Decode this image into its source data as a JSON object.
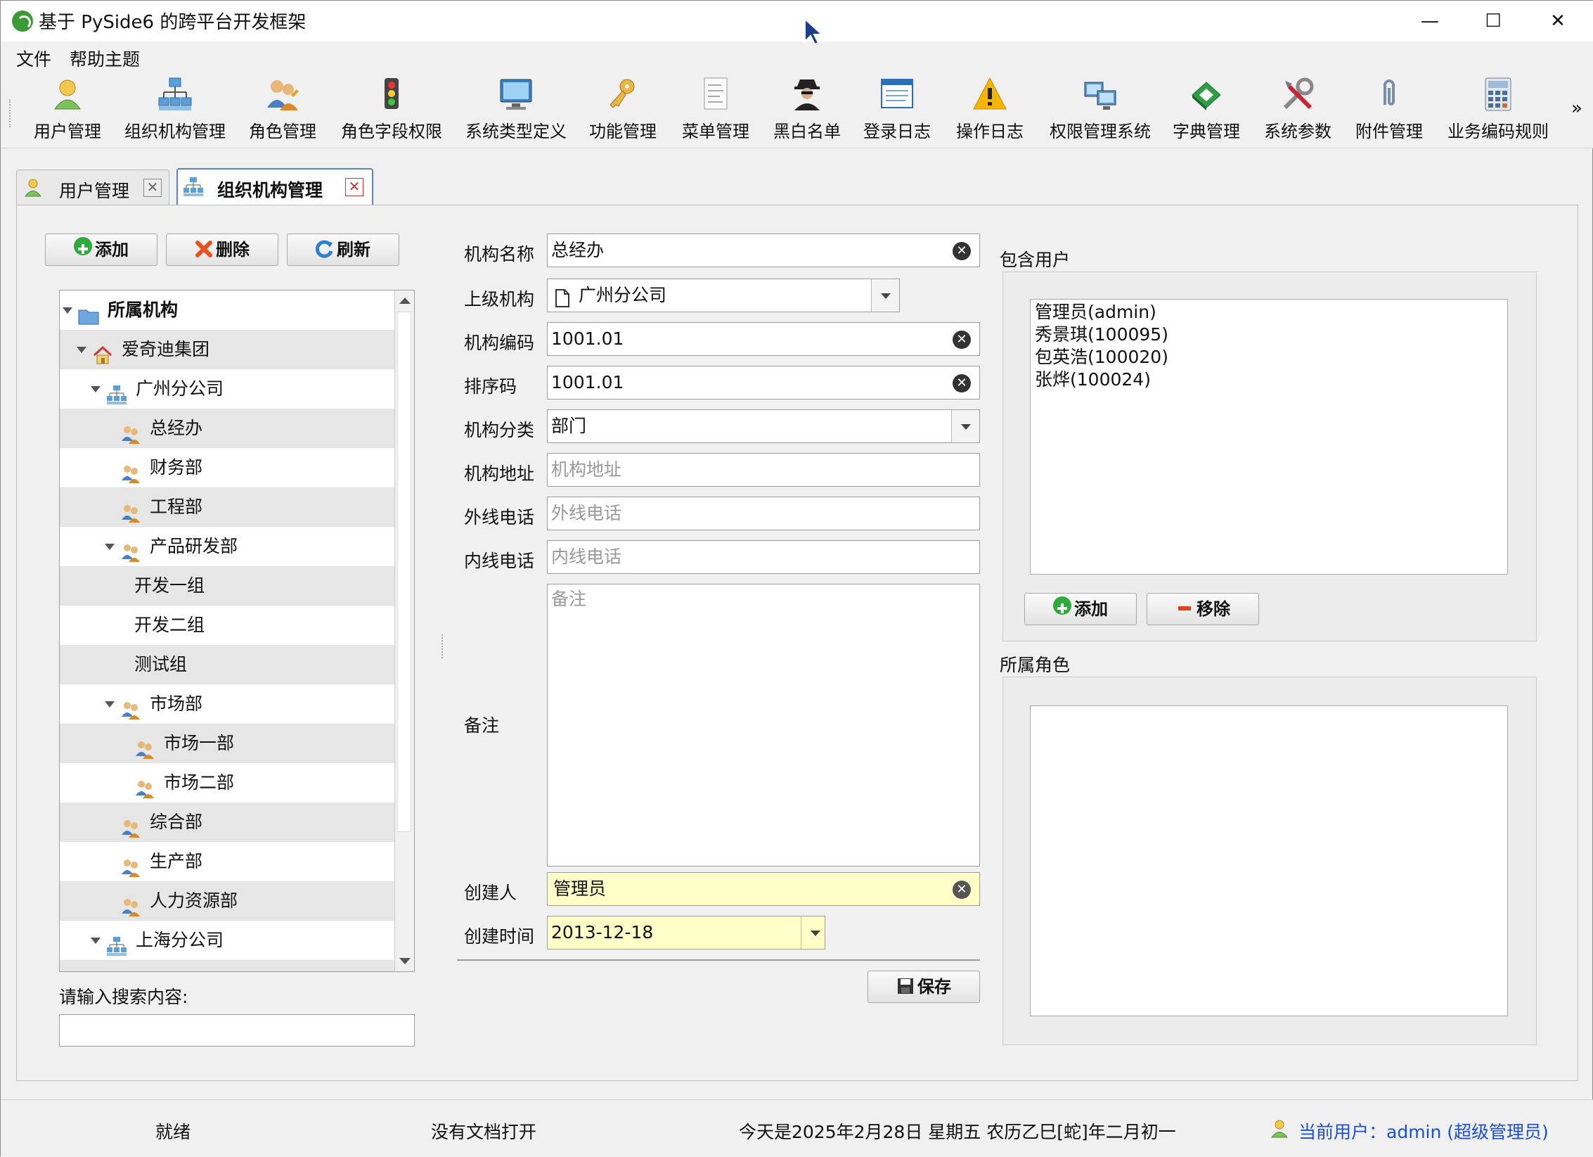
{
  "window": {
    "title": "基于 PySide6 的跨平台开发框架",
    "min_glyph": "—",
    "max_glyph": "☐",
    "close_glyph": "✕"
  },
  "menu": [
    "文件",
    "帮助主题"
  ],
  "toolbar": {
    "items": [
      "用户管理",
      "组织机构管理",
      "角色管理",
      "角色字段权限",
      "系统类型定义",
      "功能管理",
      "菜单管理",
      "黑白名单",
      "登录日志",
      "操作日志",
      "权限管理系统",
      "字典管理",
      "系统参数",
      "附件管理",
      "业务编码规则"
    ],
    "overflow": "»"
  },
  "tabs": [
    {
      "label": "用户管理",
      "close": "✕"
    },
    {
      "label": "组织机构管理",
      "close": "✕"
    }
  ],
  "left": {
    "add": "添加",
    "delete": "删除",
    "refresh": "刷新",
    "tree": [
      {
        "label": "所属机构",
        "bold": true
      },
      {
        "label": "爱奇迪集团"
      },
      {
        "label": "广州分公司"
      },
      {
        "label": "总经办"
      },
      {
        "label": "财务部"
      },
      {
        "label": "工程部"
      },
      {
        "label": "产品研发部"
      },
      {
        "label": "开发一组"
      },
      {
        "label": "开发二组"
      },
      {
        "label": "测试组"
      },
      {
        "label": "市场部"
      },
      {
        "label": "市场一部"
      },
      {
        "label": "市场二部"
      },
      {
        "label": "综合部"
      },
      {
        "label": "生产部"
      },
      {
        "label": "人力资源部"
      },
      {
        "label": "上海分公司"
      }
    ],
    "search_label": "请输入搜索内容:",
    "search_value": ""
  },
  "form": {
    "name_label": "机构名称",
    "name": "总经办",
    "parent_label": "上级机构",
    "parent": "广州分公司",
    "code_label": "机构编码",
    "code": "1001.01",
    "sort_label": "排序码",
    "sort": "1001.01",
    "category_label": "机构分类",
    "category": "部门",
    "address_label": "机构地址",
    "address_ph": "机构地址",
    "outer_phone_label": "外线电话",
    "outer_phone_ph": "外线电话",
    "inner_phone_label": "内线电话",
    "inner_phone_ph": "内线电话",
    "note_label": "备注",
    "note_ph": "备注",
    "creator_label": "创建人",
    "creator": "管理员",
    "created_label": "创建时间",
    "created": "2013-12-18",
    "save": "保存"
  },
  "right": {
    "users_title": "包含用户",
    "users": [
      "管理员(admin)",
      "秀景琪(100095)",
      "包英浩(100020)",
      "张烨(100024)"
    ],
    "add": "添加",
    "remove": "移除",
    "roles_title": "所属角色"
  },
  "status": {
    "ready": "就绪",
    "doc": "没有文档打开",
    "date": "今天是2025年2月28日 星期五 农历乙巳[蛇]年二月初一",
    "user": "当前用户：admin (超级管理员)"
  },
  "colors": {
    "accent": "#1a4fd6",
    "field_yellow": "#ffffc8",
    "tab_border": "#5a84c8"
  }
}
